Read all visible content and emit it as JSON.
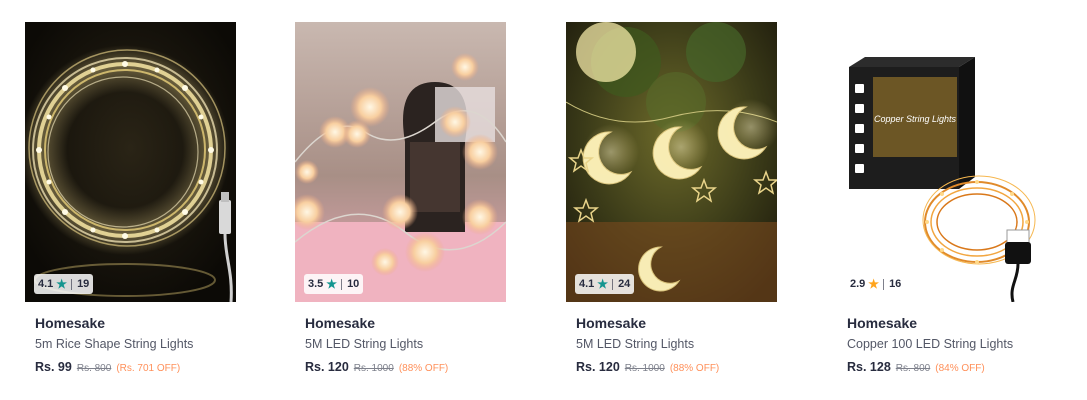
{
  "products": [
    {
      "brand": "Homesake",
      "name": "5m Rice Shape String Lights",
      "price": "Rs. 99",
      "mrp": "Rs. 800",
      "discount": "(Rs. 701 OFF)",
      "rating": "4.1",
      "rating_count": "19",
      "star_color": "#14958f",
      "image_icon": "string-lights-ring-image"
    },
    {
      "brand": "Homesake",
      "name": "5M LED String Lights",
      "price": "Rs. 120",
      "mrp": "Rs. 1000",
      "discount": "(88% OFF)",
      "rating": "3.5",
      "rating_count": "10",
      "star_color": "#14958f",
      "image_icon": "fluffy-ball-lights-image"
    },
    {
      "brand": "Homesake",
      "name": "5M LED String Lights",
      "price": "Rs. 120",
      "mrp": "Rs. 1000",
      "discount": "(88% OFF)",
      "rating": "4.1",
      "rating_count": "24",
      "star_color": "#14958f",
      "image_icon": "moon-star-lights-image"
    },
    {
      "brand": "Homesake",
      "name": "Copper 100 LED String Lights",
      "price": "Rs. 128",
      "mrp": "Rs. 800",
      "discount": "(84% OFF)",
      "rating": "2.9",
      "rating_count": "16",
      "star_color": "#ffa41c",
      "image_icon": "copper-lights-box-image",
      "package_text": "Copper String Lights"
    }
  ]
}
